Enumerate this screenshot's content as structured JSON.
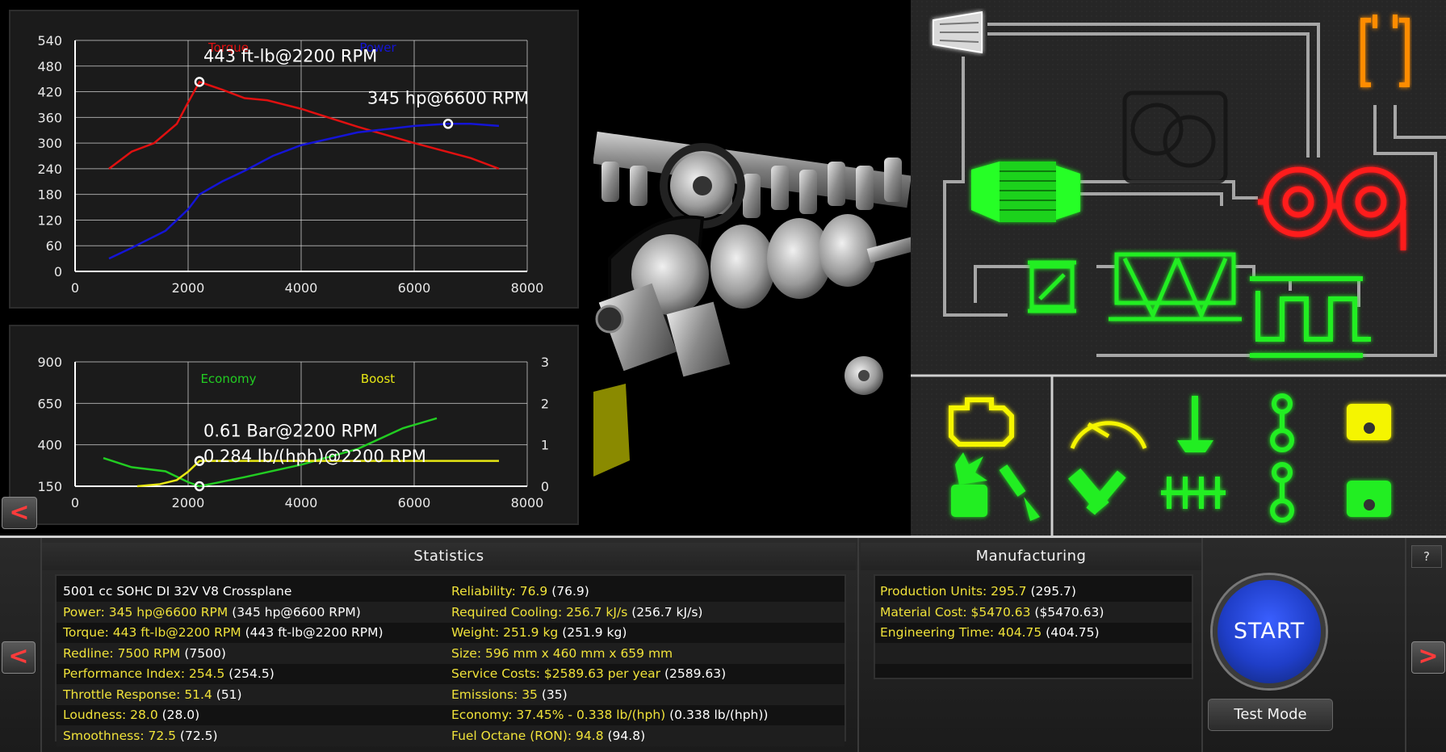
{
  "torque_chart": {
    "chart_data": {
      "type": "line",
      "x_ticks": [
        "0",
        "2000",
        "4000",
        "6000",
        "8000"
      ],
      "y_ticks": [
        "0",
        "60",
        "120",
        "180",
        "240",
        "300",
        "360",
        "420",
        "480",
        "540"
      ],
      "xlim": [
        0,
        8000
      ],
      "ylim": [
        0,
        540
      ],
      "grid": true,
      "legend": [
        "Torque",
        "Power"
      ],
      "series": [
        {
          "name": "Torque",
          "color": "#e01010",
          "x": [
            600,
            1000,
            1400,
            1800,
            2000,
            2200,
            2600,
            3000,
            3400,
            4000,
            5000,
            6000,
            7000,
            7500
          ],
          "y": [
            240,
            280,
            300,
            345,
            395,
            443,
            425,
            405,
            400,
            380,
            338,
            300,
            265,
            240
          ]
        },
        {
          "name": "Power",
          "color": "#1414d6",
          "x": [
            600,
            1000,
            1600,
            2000,
            2200,
            2600,
            3000,
            3500,
            4000,
            5000,
            6000,
            6600,
            7000,
            7500
          ],
          "y": [
            30,
            55,
            95,
            145,
            180,
            210,
            235,
            270,
            295,
            325,
            340,
            345,
            345,
            340
          ]
        }
      ],
      "annotations": [
        {
          "text": "443 ft-lb@2200 RPM",
          "x": 2200,
          "y": 443
        },
        {
          "text": "345 hp@6600 RPM",
          "x": 6600,
          "y": 345
        }
      ]
    }
  },
  "economy_chart": {
    "chart_data": {
      "type": "line",
      "x_ticks": [
        "0",
        "2000",
        "4000",
        "6000",
        "8000"
      ],
      "y_ticks_left": [
        "150",
        "400",
        "650",
        "900"
      ],
      "y_ticks_right": [
        "0",
        "1",
        "2",
        "3"
      ],
      "xlim": [
        0,
        8000
      ],
      "ylim_left": [
        150,
        900
      ],
      "ylim_right": [
        0,
        3
      ],
      "grid": true,
      "legend": [
        "Economy",
        "Boost"
      ],
      "series": [
        {
          "name": "Economy",
          "color": "#22cc22",
          "axis": "left",
          "x": [
            500,
            1000,
            1600,
            2000,
            2200,
            3000,
            4000,
            5000,
            5800,
            6400
          ],
          "y": [
            320,
            265,
            240,
            175,
            150,
            205,
            280,
            375,
            500,
            560
          ]
        },
        {
          "name": "Boost",
          "color": "#e6e614",
          "axis": "right",
          "x": [
            1100,
            1500,
            1800,
            2000,
            2200,
            3000,
            4000,
            5000,
            6000,
            7500
          ],
          "y": [
            0,
            0.05,
            0.15,
            0.35,
            0.61,
            0.61,
            0.61,
            0.61,
            0.61,
            0.61
          ]
        }
      ],
      "annotations": [
        {
          "text": "0.61 Bar@2200 RPM",
          "x": 2200,
          "y": 0.61
        },
        {
          "text": "0.284 lb/(hph)@2200 RPM",
          "x": 2200,
          "y": 150
        }
      ]
    }
  },
  "back_chart_label": "<",
  "statistics": {
    "title": "Statistics",
    "left": [
      {
        "label": "5001 cc SOHC DI 32V V8 Crossplane",
        "value": ""
      },
      {
        "label": "Power: 345 hp@6600 RPM",
        "value": "(345 hp@6600 RPM)"
      },
      {
        "label": "Torque: 443 ft-lb@2200 RPM",
        "value": "(443 ft-lb@2200 RPM)"
      },
      {
        "label": "Redline: 7500 RPM",
        "value": "(7500)"
      },
      {
        "label": "Performance Index: 254.5",
        "value": "(254.5)"
      },
      {
        "label": "Throttle Response: 51.4",
        "value": "(51)"
      },
      {
        "label": "Loudness: 28.0",
        "value": "(28.0)"
      },
      {
        "label": "Smoothness: 72.5",
        "value": "(72.5)"
      }
    ],
    "right": [
      {
        "label": "Reliability: 76.9",
        "value": "(76.9)"
      },
      {
        "label": "Required Cooling: 256.7 kJ/s",
        "value": "(256.7 kJ/s)"
      },
      {
        "label": "Weight: 251.9 kg",
        "value": "(251.9 kg)"
      },
      {
        "label": "Size: 596 mm x 460 mm x 659 mm",
        "value": ""
      },
      {
        "label": "Service Costs: $2589.63 per year",
        "value": "(2589.63)"
      },
      {
        "label": "Emissions: 35",
        "value": "(35)"
      },
      {
        "label": "Economy: 37.45% - 0.338 lb/(hph)",
        "value": "(0.338 lb/(hph))"
      },
      {
        "label": "Fuel Octane (RON): 94.8",
        "value": "(94.8)"
      }
    ]
  },
  "manufacturing": {
    "title": "Manufacturing",
    "rows": [
      {
        "label": "Production Units: 295.7",
        "value": "(295.7)"
      },
      {
        "label": "Material Cost: $5470.63",
        "value": "($5470.63)"
      },
      {
        "label": "Engineering Time: 404.75",
        "value": "(404.75)"
      }
    ]
  },
  "buttons": {
    "start": "START",
    "test_mode": "Test Mode",
    "help": "?",
    "prev": "<",
    "next": ">"
  },
  "colors": {
    "highlight_yellow": "#f0e23a",
    "schematic_green": "#22ee22",
    "schematic_red": "#ff1a1a",
    "schematic_orange": "#ff8c00",
    "schematic_yellow": "#f5f500"
  }
}
